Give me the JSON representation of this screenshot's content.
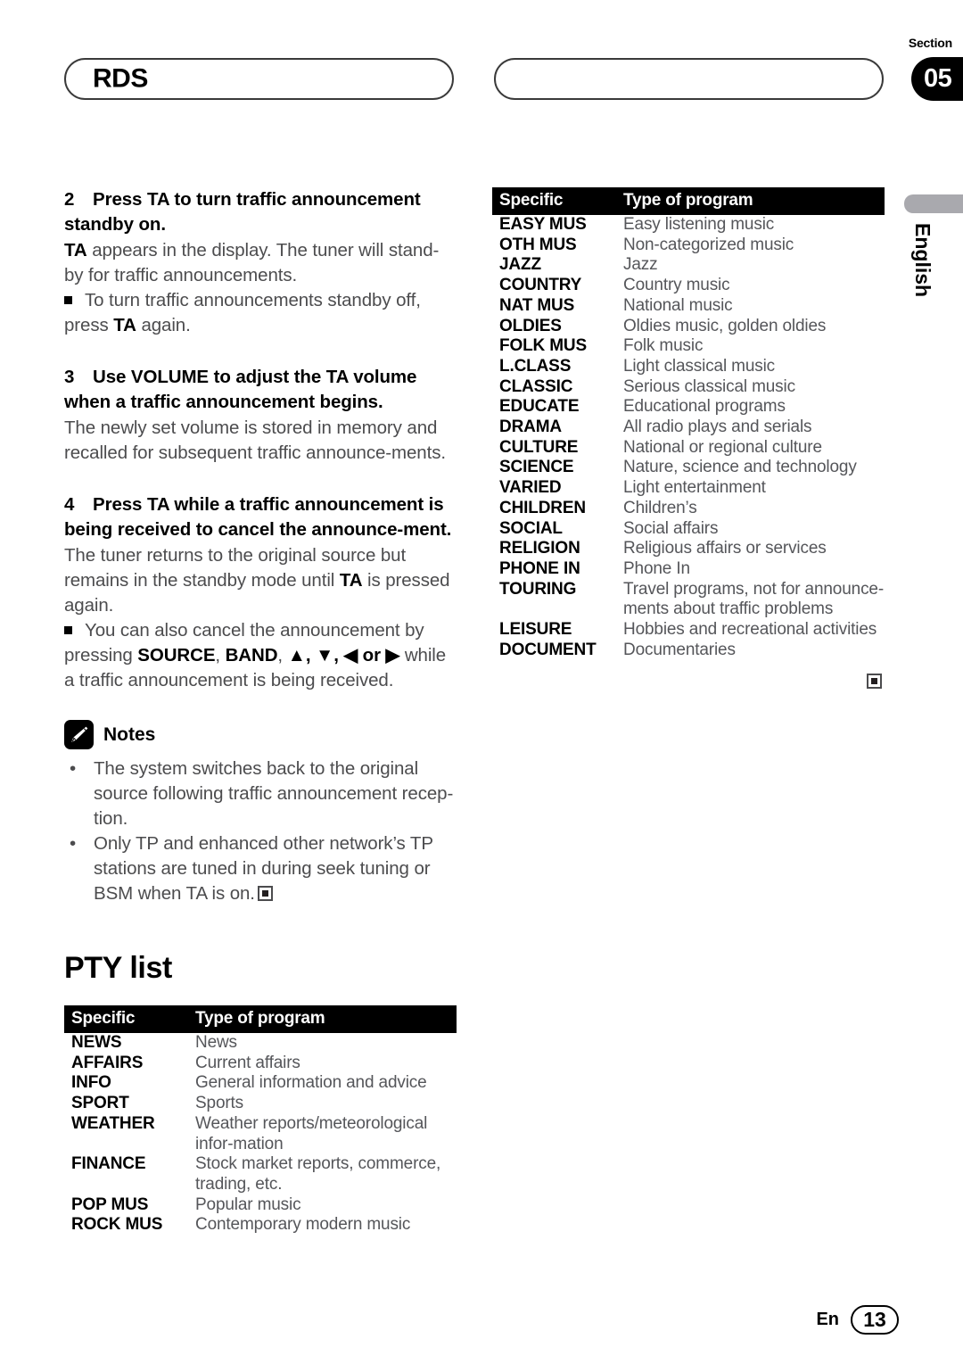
{
  "header": {
    "title": "RDS",
    "right_pill_text": "",
    "section_label": "Section",
    "section_number": "05"
  },
  "side_tab": {
    "language": "English"
  },
  "left_column": {
    "steps": [
      {
        "number": "2",
        "heading": "Press TA to turn traffic announcement standby on.",
        "body_prefix_bold": "TA",
        "body": " appears in the display. The tuner will stand-by for traffic announcements.",
        "sub_bullet_pre": "To turn traffic announcements standby off, press ",
        "sub_bullet_bold": "TA",
        "sub_bullet_post": " again."
      },
      {
        "number": "3",
        "heading": "Use VOLUME to adjust the TA volume when a traffic announcement begins.",
        "body": "The newly set volume is stored in memory and recalled for subsequent traffic announce-ments."
      },
      {
        "number": "4",
        "heading": "Press TA while a traffic announcement is being received to cancel the announce-ment.",
        "body_pre": "The tuner returns to the original source but remains in the standby mode until ",
        "body_bold": "TA",
        "body_post": " is pressed again.",
        "sub_bullet_pre": "You can also cancel the announcement by pressing ",
        "sub_bullet_b1": "SOURCE",
        "sub_bullet_sep1": ", ",
        "sub_bullet_b2": "BAND",
        "sub_bullet_sep2": ", ",
        "sub_bullet_arrows": "▲, ▼, ◀ or ▶",
        "sub_bullet_post": " while a traffic announcement is being received."
      }
    ],
    "notes": {
      "icon": "pencil-icon",
      "title": "Notes",
      "items": [
        "The system switches back to the original source following traffic announcement recep-tion.",
        "Only TP and enhanced other network’s TP stations are tuned in during seek tuning or BSM when TA is on."
      ],
      "end_marker": "end-of-section-marker"
    },
    "pty_heading": "PTY list",
    "table": {
      "columns": [
        "Specific",
        "Type of program"
      ],
      "rows": [
        [
          "NEWS",
          "News"
        ],
        [
          "AFFAIRS",
          "Current affairs"
        ],
        [
          "INFO",
          "General information and advice"
        ],
        [
          "SPORT",
          "Sports"
        ],
        [
          "WEATHER",
          "Weather reports/meteorological infor-mation"
        ],
        [
          "FINANCE",
          "Stock market reports, commerce, trading, etc."
        ],
        [
          "POP MUS",
          "Popular music"
        ],
        [
          "ROCK MUS",
          "Contemporary modern music"
        ]
      ]
    }
  },
  "right_column": {
    "table": {
      "columns": [
        "Specific",
        "Type of program"
      ],
      "rows": [
        [
          "EASY MUS",
          "Easy listening music"
        ],
        [
          "OTH MUS",
          "Non-categorized music"
        ],
        [
          "JAZZ",
          "Jazz"
        ],
        [
          "COUNTRY",
          "Country music"
        ],
        [
          "NAT MUS",
          "National music"
        ],
        [
          "OLDIES",
          "Oldies music, golden oldies"
        ],
        [
          "FOLK MUS",
          "Folk music"
        ],
        [
          "L.CLASS",
          "Light classical music"
        ],
        [
          "CLASSIC",
          "Serious classical music"
        ],
        [
          "EDUCATE",
          "Educational programs"
        ],
        [
          "DRAMA",
          "All radio plays and serials"
        ],
        [
          "CULTURE",
          "National or regional culture"
        ],
        [
          "SCIENCE",
          "Nature, science and technology"
        ],
        [
          "VARIED",
          "Light entertainment"
        ],
        [
          "CHILDREN",
          "Children’s"
        ],
        [
          "SOCIAL",
          "Social affairs"
        ],
        [
          "RELIGION",
          "Religious affairs or services"
        ],
        [
          "PHONE IN",
          "Phone In"
        ],
        [
          "TOURING",
          "Travel programs, not for announce-ments about traffic problems"
        ],
        [
          "LEISURE",
          "Hobbies and recreational activities"
        ],
        [
          "DOCUMENT",
          "Documentaries"
        ]
      ]
    },
    "end_marker": "end-of-section-marker"
  },
  "footer": {
    "language": "En",
    "page_number": "13"
  },
  "colors": {
    "text_black": "#000000",
    "body_gray": "#4c4c4e",
    "table_header_bg": "#000000",
    "tab_gray": "#a9a9ae"
  }
}
